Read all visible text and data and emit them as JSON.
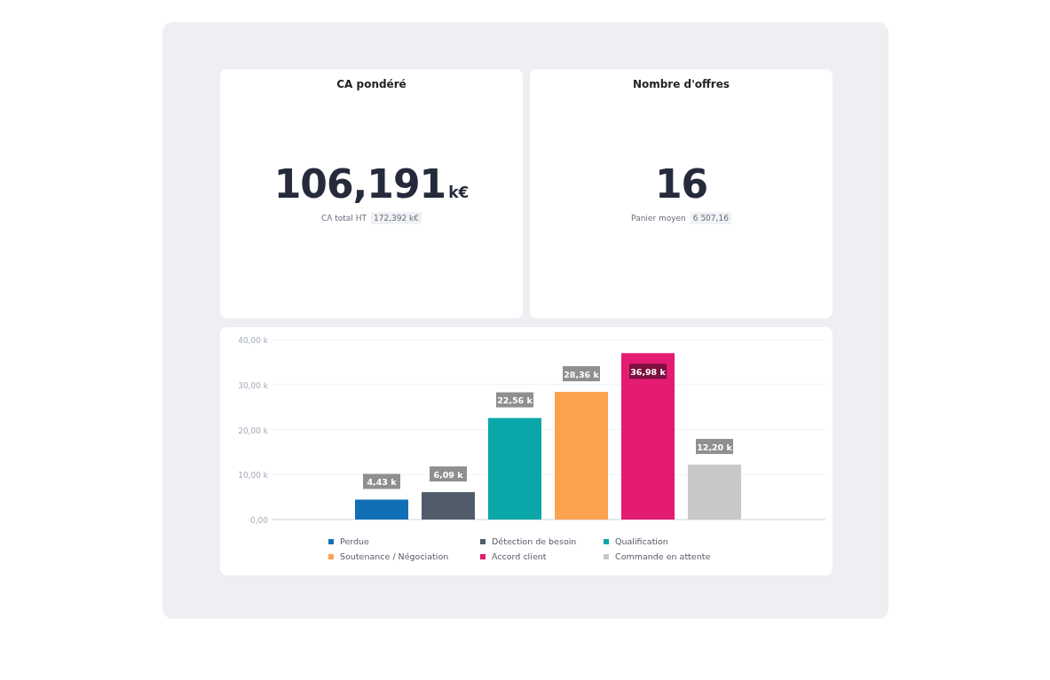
{
  "cards": [
    {
      "title": "CA pondéré",
      "value": "106,191",
      "unit": "k€",
      "sub_label": "CA total HT",
      "sub_value": "172,392 k€"
    },
    {
      "title": "Nombre d'offres",
      "value": "16",
      "sub_label": "Panier moyen",
      "sub_value": "6 507,16"
    }
  ],
  "chart": {
    "chart_data": {
      "type": "bar",
      "grid": true,
      "ylim": [
        0,
        40
      ],
      "yticks": [
        {
          "value": 0,
          "label": "0,00"
        },
        {
          "value": 10,
          "label": "10,00 k"
        },
        {
          "value": 20,
          "label": "20,00 k"
        },
        {
          "value": 30,
          "label": "30,00 k"
        },
        {
          "value": 40,
          "label": "40,00 k"
        }
      ],
      "series": [
        {
          "name": "Perdue",
          "color": "#1170b5",
          "values": [
            4.43
          ]
        },
        {
          "name": "Détection de besoin",
          "color": "#505c6a",
          "values": [
            6.09
          ]
        },
        {
          "name": "Qualification",
          "color": "#0aa6a8",
          "values": [
            22.56
          ]
        },
        {
          "name": "Soutenance / Négociation",
          "color": "#fba24f",
          "values": [
            28.36
          ]
        },
        {
          "name": "Accord client",
          "color": "#e31c71",
          "values": [
            36.98
          ]
        },
        {
          "name": "Commande en attente",
          "color": "#c9c8c6",
          "values": [
            12.2
          ]
        }
      ],
      "value_labels": [
        "4,43 k",
        "6,09 k",
        "22,56 k",
        "28,36 k",
        "36,98 k",
        "12,20 k"
      ]
    }
  }
}
